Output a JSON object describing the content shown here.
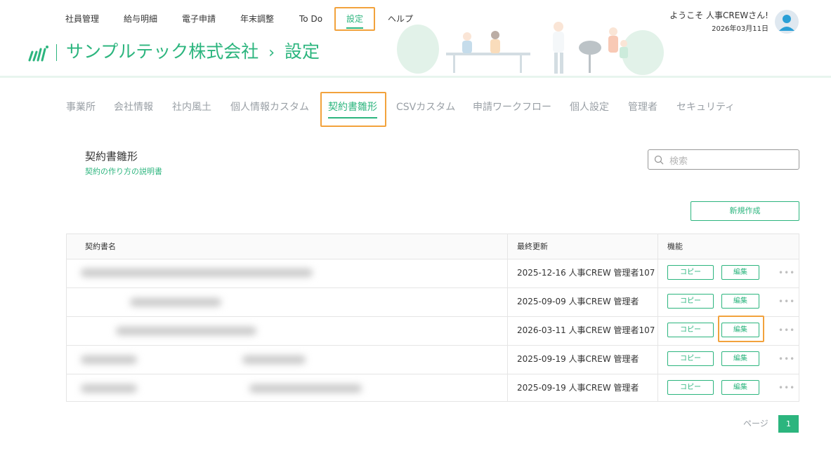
{
  "top_nav": {
    "items": [
      {
        "label": "社員管理"
      },
      {
        "label": "給与明細"
      },
      {
        "label": "電子申請"
      },
      {
        "label": "年末調整"
      },
      {
        "label": "To Do"
      },
      {
        "label": "設定",
        "active": true
      },
      {
        "label": "ヘルプ"
      }
    ]
  },
  "header": {
    "company": "サンプルテック株式会社",
    "breadcrumb_sep": "›",
    "page": "設定",
    "welcome": "ようこそ 人事CREWさん!",
    "date": "2026年03月11日"
  },
  "tabs": [
    {
      "label": "事業所"
    },
    {
      "label": "会社情報"
    },
    {
      "label": "社内風土"
    },
    {
      "label": "個人情報カスタム"
    },
    {
      "label": "契約書雛形",
      "active": true
    },
    {
      "label": "CSVカスタム"
    },
    {
      "label": "申請ワークフロー"
    },
    {
      "label": "個人設定"
    },
    {
      "label": "管理者"
    },
    {
      "label": "セキュリティ"
    }
  ],
  "section": {
    "title": "契約書雛形",
    "help_link": "契約の作り方の説明書"
  },
  "search": {
    "placeholder": "検索",
    "value": ""
  },
  "new_button": "新規作成",
  "table": {
    "columns": [
      "契約書名",
      "最終更新",
      "機能"
    ],
    "rows": [
      {
        "updated": "2025-12-16 人事CREW 管理者107",
        "copy": "コピー",
        "edit": "編集",
        "more": "•••"
      },
      {
        "updated": "2025-09-09 人事CREW 管理者",
        "copy": "コピー",
        "edit": "編集",
        "more": "•••"
      },
      {
        "updated": "2026-03-11 人事CREW 管理者107",
        "copy": "コピー",
        "edit": "編集",
        "more": "•••"
      },
      {
        "updated": "2025-09-19 人事CREW 管理者",
        "copy": "コピー",
        "edit": "編集",
        "more": "•••"
      },
      {
        "updated": "2025-09-19 人事CREW 管理者",
        "copy": "コピー",
        "edit": "編集",
        "more": "•••"
      }
    ]
  },
  "pagination": {
    "label": "ページ",
    "current": "1"
  },
  "colors": {
    "accent": "#2cb57e",
    "highlight": "#f2a23c"
  }
}
